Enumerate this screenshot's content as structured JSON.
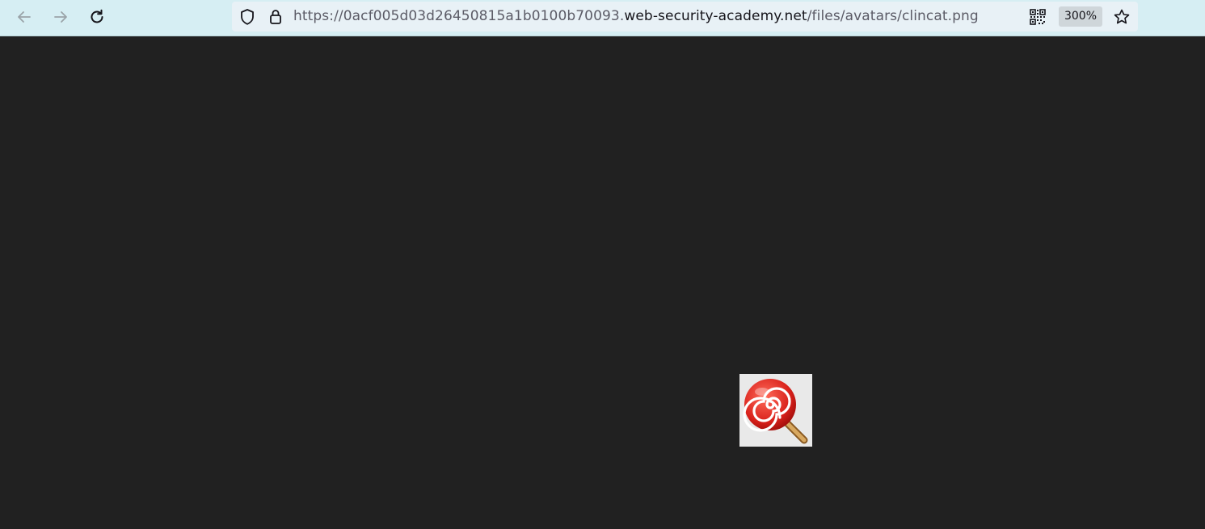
{
  "browser": {
    "url_prefix": "https://0acf005d03d26450815a1b0100b70093.",
    "url_domain": "web-security-academy.net",
    "url_path": "/files/avatars/clincat.png",
    "zoom_level": "300%",
    "icons": {
      "back": "arrow-left-icon",
      "forward": "arrow-right-icon",
      "reload": "reload-icon",
      "shield": "shield-icon",
      "lock": "lock-icon",
      "qr": "qr-code-icon",
      "bookmark": "star-icon"
    }
  },
  "page": {
    "background_color": "#212121",
    "image_description_icon": "lollipop-icon"
  }
}
